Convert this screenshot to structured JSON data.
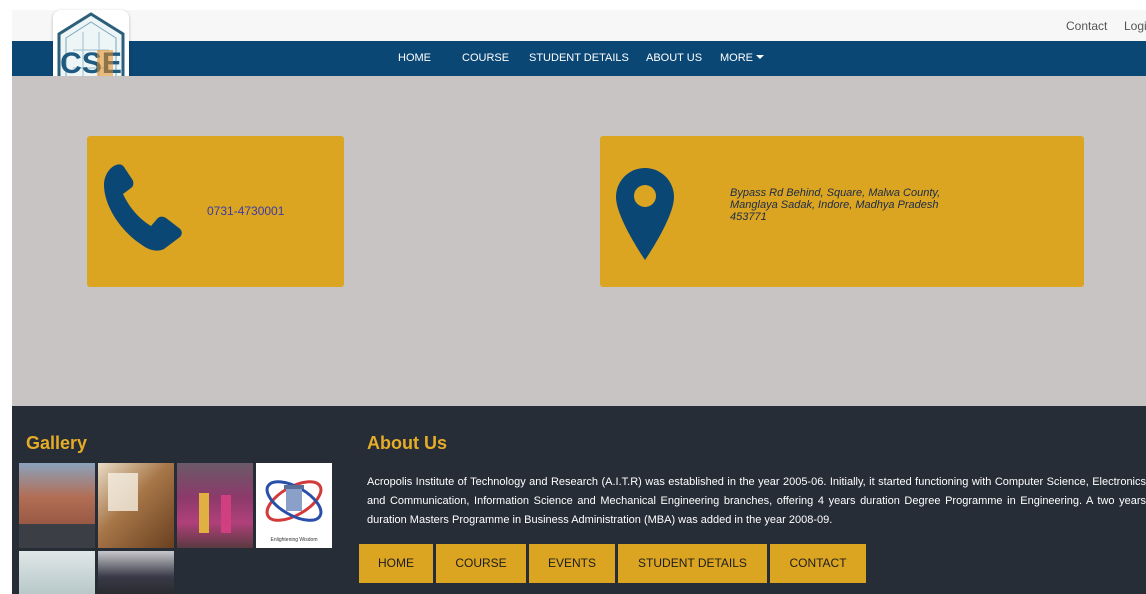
{
  "header": {
    "links": [
      "Contact",
      "Login"
    ]
  },
  "nav": {
    "items": [
      "HOME",
      "COURSE",
      "STUDENT DETAILS",
      "ABOUT US",
      "MORE"
    ]
  },
  "logo": {
    "text": "CSE"
  },
  "contact_cards": {
    "phone": "0731-4730001",
    "address_line1": "Bypass Rd Behind, Square, Malwa County,",
    "address_line2": "Manglaya Sadak, Indore, Madhya Pradesh",
    "address_line3": "453771"
  },
  "footer": {
    "gallery_title": "Gallery",
    "about_title": "About Us",
    "about_text": "Acropolis Institute of Technology and Research (A.I.T.R) was established in the year 2005-06. Initially, it started functioning with Computer Science, Electronics and Communication, Information Science and Mechanical Engineering branches, offering 4 years duration Degree Programme in Engineering. A two years duration Masters Programme in Business Administration (MBA) was added in the year 2008-09.",
    "buttons": [
      "HOME",
      "COURSE",
      "EVENTS",
      "STUDENT DETAILS",
      "CONTACT"
    ],
    "emblem_caption": "Enlightening Wisdom"
  },
  "colors": {
    "navbar": "#0b4775",
    "card": "#dba522",
    "main_bg": "#c8c4c4",
    "footer_bg": "#262d36",
    "accent": "#e5ac28"
  }
}
